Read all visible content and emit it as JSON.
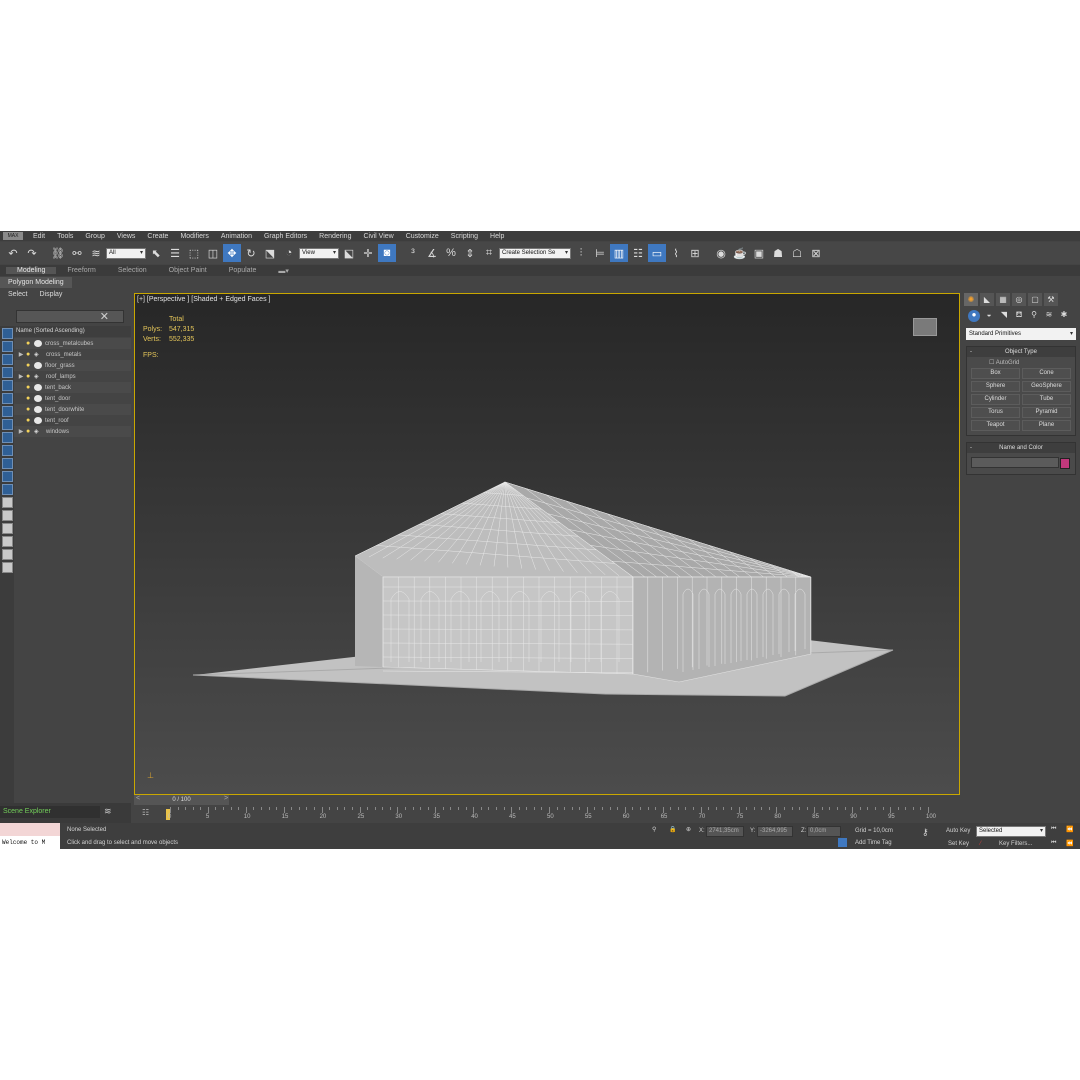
{
  "menu": {
    "logo": "MAX",
    "items": [
      "Edit",
      "Tools",
      "Group",
      "Views",
      "Create",
      "Modifiers",
      "Animation",
      "Graph Editors",
      "Rendering",
      "Civil View",
      "Customize",
      "Scripting",
      "Help"
    ]
  },
  "toolbar": {
    "filter_value": "All",
    "coord_value": "View",
    "selection_set_placeholder": "Create Selection Se"
  },
  "ribbon": {
    "tabs": [
      "Modeling",
      "Freeform",
      "Selection",
      "Object Paint",
      "Populate"
    ],
    "active_panel": "Polygon Modeling"
  },
  "explorer": {
    "tabs": [
      "Select",
      "Display"
    ],
    "header": "Name (Sorted Ascending)",
    "rows": [
      {
        "name": "cross_metalcubes",
        "expand": "",
        "kind": "object"
      },
      {
        "name": "cross_metals",
        "expand": "▶",
        "kind": "layer"
      },
      {
        "name": "floor_grass",
        "expand": "",
        "kind": "object"
      },
      {
        "name": "roof_lamps",
        "expand": "▶",
        "kind": "layer"
      },
      {
        "name": "tent_back",
        "expand": "",
        "kind": "object"
      },
      {
        "name": "tent_door",
        "expand": "",
        "kind": "object"
      },
      {
        "name": "tent_doorwhite",
        "expand": "",
        "kind": "object"
      },
      {
        "name": "tent_roof",
        "expand": "",
        "kind": "object"
      },
      {
        "name": "windows",
        "expand": "▶",
        "kind": "layer"
      }
    ],
    "footer_label": "Scene Explorer"
  },
  "viewport": {
    "label": "[+] [Perspective ] [Shaded + Edged Faces ]",
    "stats_total": "Total",
    "polys_label": "Polys:",
    "polys_value": "547,315",
    "verts_label": "Verts:",
    "verts_value": "552,335",
    "fps_label": "FPS:"
  },
  "timeline": {
    "slider": "0 / 100",
    "ticks": [
      "0",
      "5",
      "10",
      "15",
      "20",
      "25",
      "30",
      "35",
      "40",
      "45",
      "50",
      "55",
      "60",
      "65",
      "70",
      "75",
      "80",
      "85",
      "90",
      "95",
      "100"
    ]
  },
  "status": {
    "selection": "None Selected",
    "prompt": "Click and drag to select and move objects",
    "maxscript": "Welcome to M",
    "x_label": "X:",
    "x_value": "2741,35cm",
    "y_label": "Y:",
    "y_value": "-3264,995",
    "z_label": "Z:",
    "z_value": "0,0cm",
    "grid": "Grid = 10,0cm",
    "add_time_tag": "Add Time Tag",
    "auto_key": "Auto Key",
    "set_key": "Set Key",
    "key_mode": "Selected",
    "key_filters": "Key Filters..."
  },
  "command_panel": {
    "category": "Standard Primitives",
    "object_type_title": "Object Type",
    "autogrid": "AutoGrid",
    "primitives": [
      "Box",
      "Cone",
      "Sphere",
      "GeoSphere",
      "Cylinder",
      "Tube",
      "Torus",
      "Pyramid",
      "Teapot",
      "Plane"
    ],
    "name_color_title": "Name and Color",
    "object_color": "#c0387b"
  },
  "colors": {
    "accent": "#3f78c0",
    "viewport_border": "#c9a700",
    "stats_text": "#e5c65a"
  }
}
